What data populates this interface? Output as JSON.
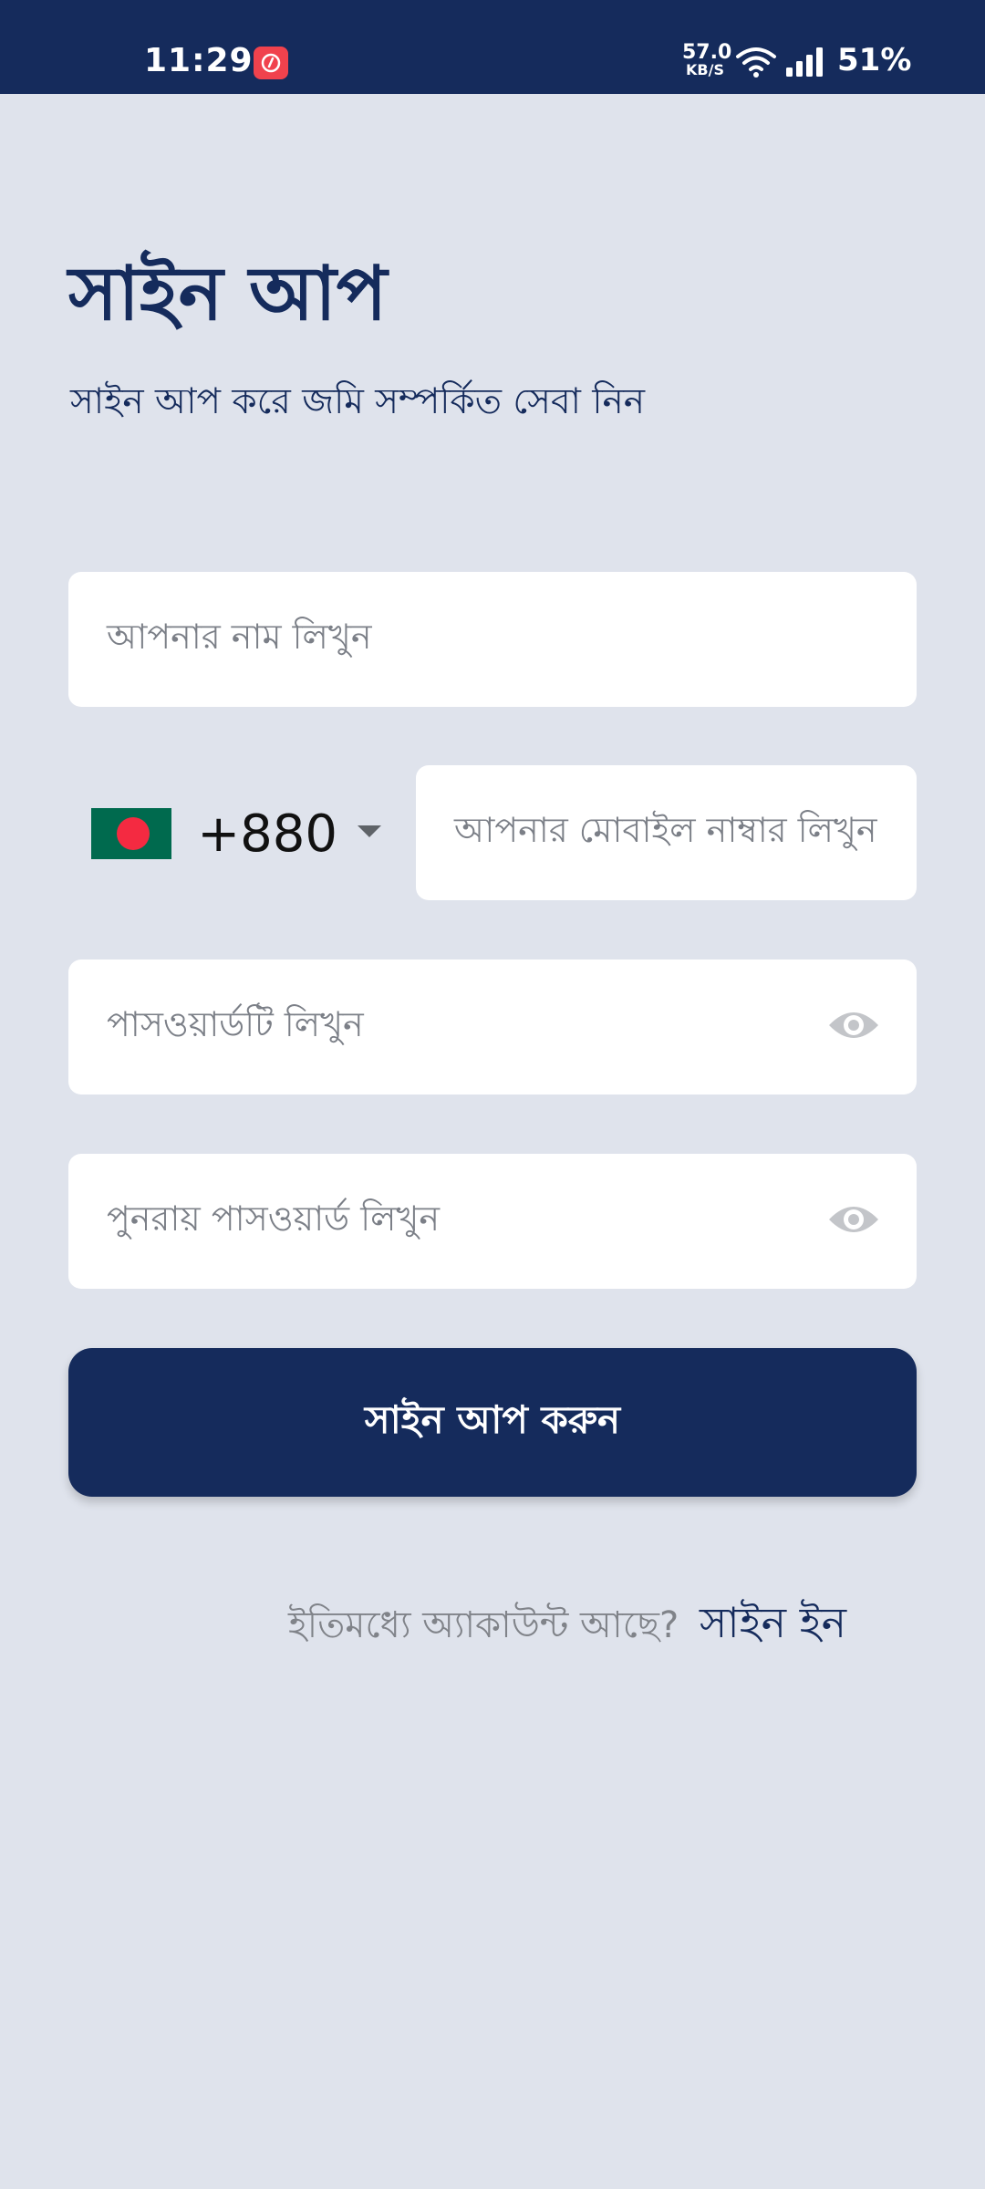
{
  "status_bar": {
    "time": "11:29",
    "net_speed_value": "57.0",
    "net_speed_unit": "KB/S",
    "battery": "51%",
    "icons": [
      "app-notification-icon",
      "wifi-icon",
      "signal-icon"
    ]
  },
  "header": {
    "title": "সাইন আপ",
    "subtitle": "সাইন আপ করে জমি সম্পর্কিত সেবা নিন"
  },
  "form": {
    "name_placeholder": "আপনার নাম লিখুন",
    "country_code": "+880",
    "country_flag": "bangladesh-flag",
    "phone_placeholder": "আপনার মোবাইল নাম্বার লিখুন",
    "password_placeholder": "পাসওয়ার্ডটি লিখুন",
    "confirm_password_placeholder": "পুনরায় পাসওয়ার্ড লিখুন",
    "submit_label": "সাইন আপ করুন"
  },
  "footer": {
    "signin_prompt": "ইতিমধ্যে অ্যাকাউন্ট আছে?",
    "signin_link": "সাইন ইন"
  },
  "colors": {
    "primary": "#152b5c",
    "background": "#dfe3ec",
    "field": "#ffffff",
    "placeholder": "#7b7f87"
  }
}
